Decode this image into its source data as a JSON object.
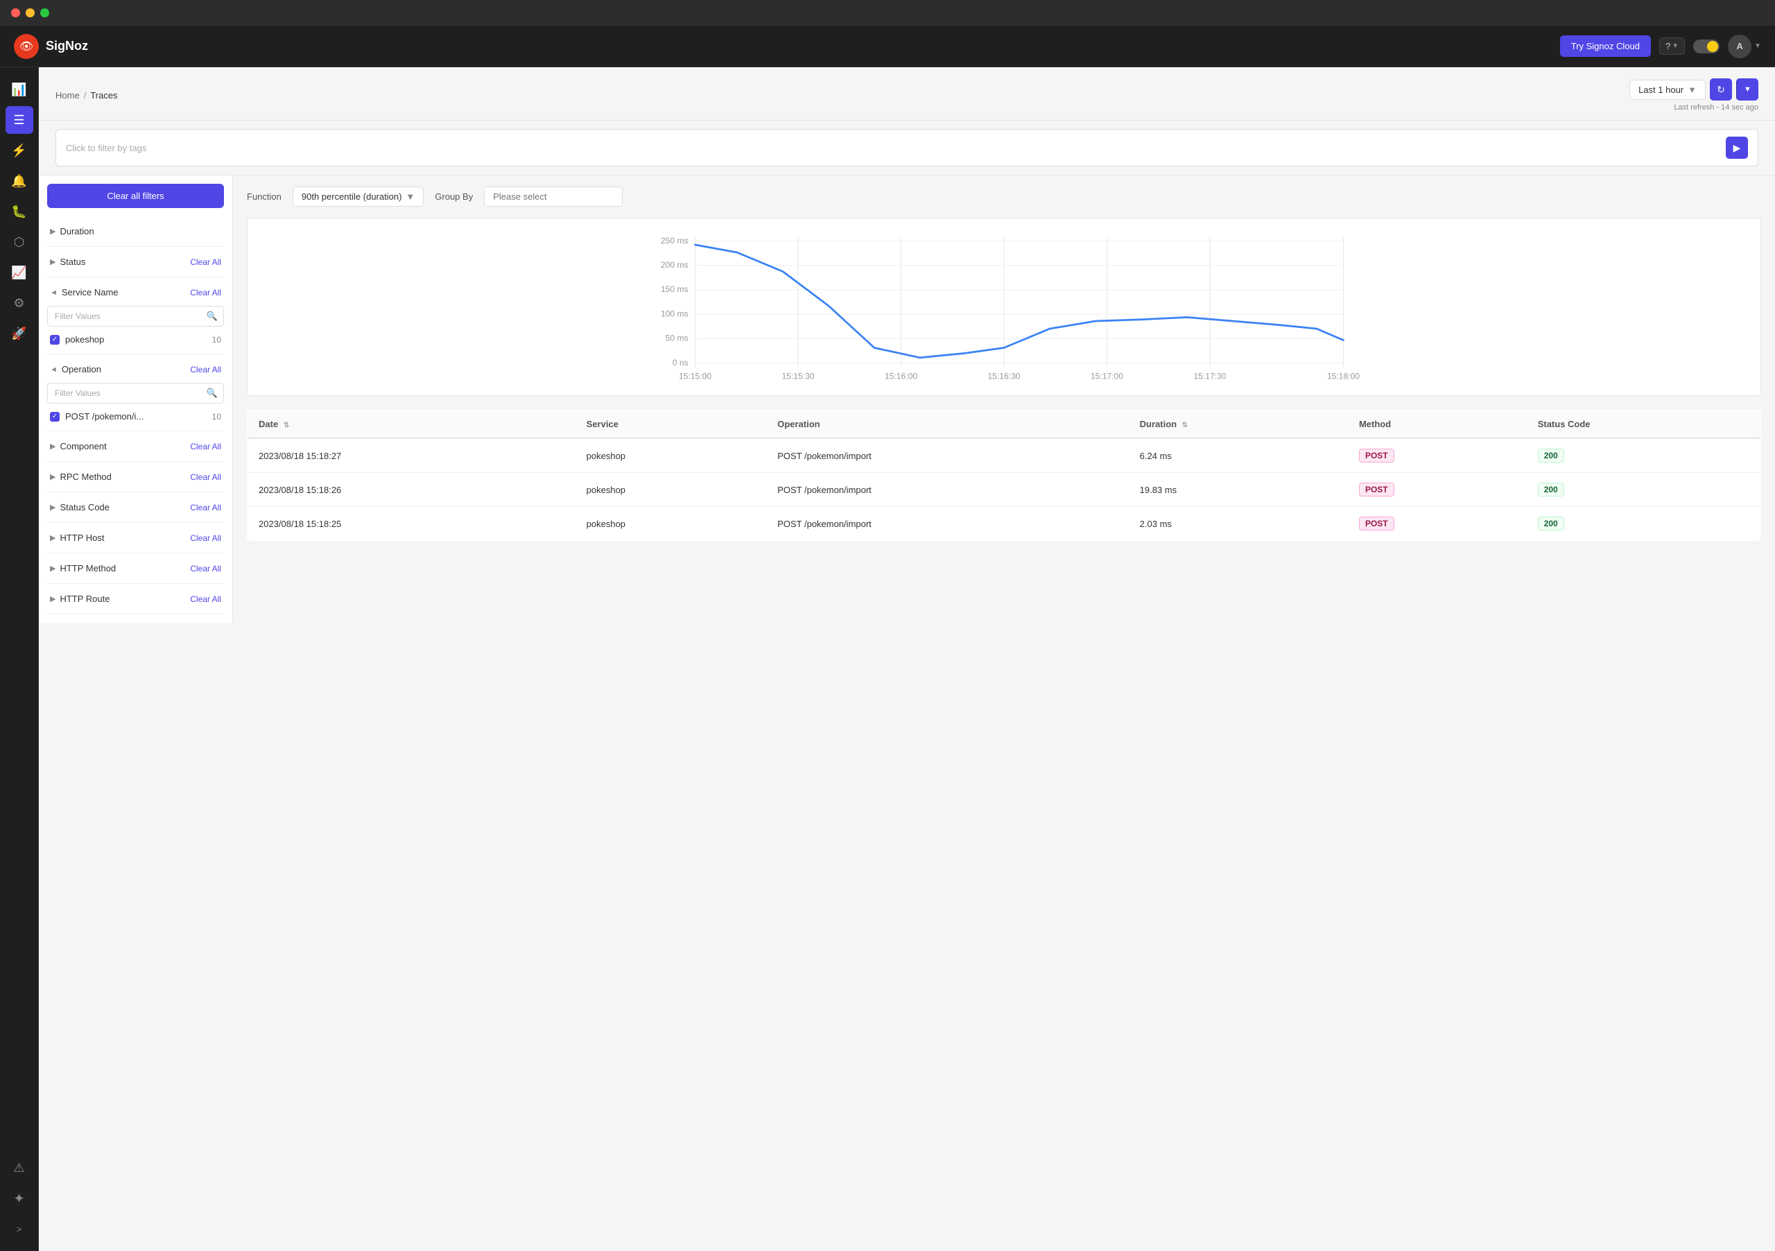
{
  "window": {
    "title": "SigNoz"
  },
  "topbar": {
    "logo_text": "SigNoz",
    "btn_cloud": "Try Signoz Cloud",
    "help_icon": "?",
    "avatar": "A",
    "time_range": "Last 1 hour",
    "last_refresh": "Last refresh - 14 sec ago"
  },
  "breadcrumb": {
    "home": "Home",
    "separator": "/",
    "current": "Traces"
  },
  "filter_bar": {
    "placeholder": "Click to filter by tags"
  },
  "left_panel": {
    "clear_all_filters": "Clear all filters",
    "sections": [
      {
        "id": "duration",
        "label": "Duration",
        "expanded": false,
        "clear_label": "",
        "has_clear": false
      },
      {
        "id": "status",
        "label": "Status",
        "expanded": false,
        "clear_label": "Clear All",
        "has_clear": true
      },
      {
        "id": "service_name",
        "label": "Service Name",
        "expanded": true,
        "clear_label": "Clear All",
        "has_clear": true,
        "search_placeholder": "Filter Values",
        "items": [
          {
            "label": "pokeshop",
            "count": 10,
            "checked": true
          }
        ]
      },
      {
        "id": "operation",
        "label": "Operation",
        "expanded": true,
        "clear_label": "Clear All",
        "has_clear": true,
        "search_placeholder": "Filter Values",
        "items": [
          {
            "label": "POST /pokemon/i...",
            "count": 10,
            "checked": true
          }
        ]
      },
      {
        "id": "component",
        "label": "Component",
        "expanded": false,
        "clear_label": "Clear All",
        "has_clear": true
      },
      {
        "id": "rpc_method",
        "label": "RPC Method",
        "expanded": false,
        "clear_label": "Clear All",
        "has_clear": true
      },
      {
        "id": "status_code",
        "label": "Status Code",
        "expanded": false,
        "clear_label": "Clear All",
        "has_clear": true
      },
      {
        "id": "http_host",
        "label": "HTTP Host",
        "expanded": false,
        "clear_label": "Clear All",
        "has_clear": true
      },
      {
        "id": "http_method",
        "label": "HTTP Method",
        "expanded": false,
        "clear_label": "Clear All",
        "has_clear": true
      },
      {
        "id": "http_route",
        "label": "HTTP Route",
        "expanded": false,
        "clear_label": "Clear All",
        "has_clear": true
      }
    ]
  },
  "chart": {
    "function_label": "Function",
    "function_value": "90th percentile (duration)",
    "group_by_label": "Group By",
    "group_by_placeholder": "Please select",
    "y_labels": [
      "250 ms",
      "200 ms",
      "150 ms",
      "100 ms",
      "50 ms",
      "0 ns"
    ],
    "x_labels": [
      "15:15:00",
      "15:15:30",
      "15:16:00",
      "15:16:30",
      "15:17:00",
      "15:17:30",
      "15:18:00"
    ]
  },
  "table": {
    "columns": [
      {
        "id": "date",
        "label": "Date",
        "sortable": true
      },
      {
        "id": "service",
        "label": "Service",
        "sortable": false
      },
      {
        "id": "operation",
        "label": "Operation",
        "sortable": false
      },
      {
        "id": "duration",
        "label": "Duration",
        "sortable": true
      },
      {
        "id": "method",
        "label": "Method",
        "sortable": false
      },
      {
        "id": "status_code",
        "label": "Status Code",
        "sortable": false
      }
    ],
    "rows": [
      {
        "date": "2023/08/18 15:18:27",
        "service": "pokeshop",
        "operation": "POST /pokemon/import",
        "duration": "6.24 ms",
        "method": "POST",
        "status_code": "200"
      },
      {
        "date": "2023/08/18 15:18:26",
        "service": "pokeshop",
        "operation": "POST /pokemon/import",
        "duration": "19.83 ms",
        "method": "POST",
        "status_code": "200"
      },
      {
        "date": "2023/08/18 15:18:25",
        "service": "pokeshop",
        "operation": "POST /pokemon/import",
        "duration": "2.03 ms",
        "method": "POST",
        "status_code": "200"
      }
    ]
  },
  "sidebar": {
    "items": [
      {
        "id": "dashboard",
        "icon": "📊",
        "label": "Dashboard"
      },
      {
        "id": "traces",
        "icon": "≡",
        "label": "Traces",
        "active": true
      },
      {
        "id": "metrics",
        "icon": "⚡",
        "label": "Metrics"
      },
      {
        "id": "alerts",
        "icon": "🔔",
        "label": "Alerts"
      },
      {
        "id": "bugs",
        "icon": "🐛",
        "label": "Bugs"
      },
      {
        "id": "topology",
        "icon": "⬡",
        "label": "Topology"
      },
      {
        "id": "analytics",
        "icon": "📈",
        "label": "Analytics"
      },
      {
        "id": "settings",
        "icon": "⚙",
        "label": "Settings"
      },
      {
        "id": "rocket",
        "icon": "🚀",
        "label": "Rocket"
      }
    ],
    "bottom": [
      {
        "id": "warning",
        "icon": "⚠",
        "label": "Warning"
      },
      {
        "id": "slack",
        "icon": "💬",
        "label": "Slack"
      }
    ],
    "expand": ">"
  }
}
